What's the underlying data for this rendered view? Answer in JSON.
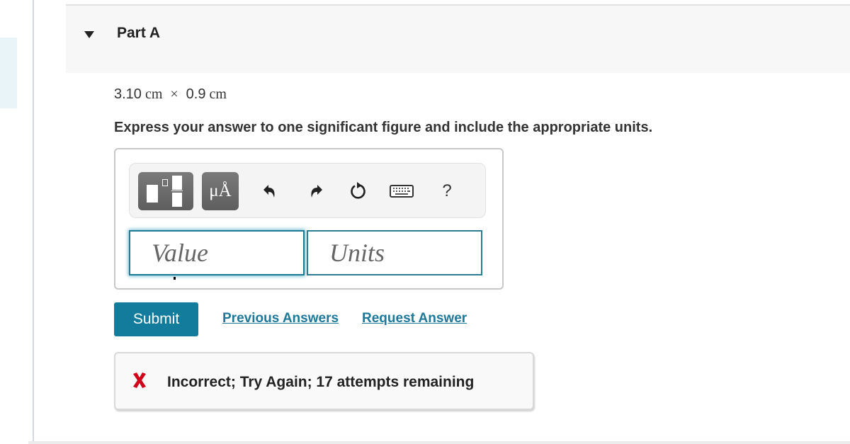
{
  "part": {
    "title": "Part A",
    "expanded": true
  },
  "problem": {
    "operand1_value": "3.10",
    "operand1_unit": "cm",
    "operator": "×",
    "operand2_value": "0.9",
    "operand2_unit": "cm"
  },
  "instructions": "Express your answer to one significant figure and include the appropriate units.",
  "toolbar": {
    "buttons": [
      {
        "icon": "templates-icon",
        "label": ""
      },
      {
        "icon": "units-icon",
        "label": "μÅ"
      },
      {
        "icon": "undo-icon",
        "label": ""
      },
      {
        "icon": "redo-icon",
        "label": ""
      },
      {
        "icon": "reset-icon",
        "label": ""
      },
      {
        "icon": "keyboard-icon",
        "label": ""
      },
      {
        "icon": "help-icon",
        "label": "?"
      }
    ]
  },
  "inputs": {
    "value_placeholder": "Value",
    "value_current": "",
    "units_placeholder": "Units",
    "units_current": ""
  },
  "actions": {
    "submit_label": "Submit",
    "previous_answers_label": "Previous Answers",
    "request_answer_label": "Request Answer"
  },
  "feedback": {
    "status": "incorrect",
    "message": "Incorrect; Try Again; 17 attempts remaining",
    "attempts_remaining": 17
  },
  "colors": {
    "accent": "#137b9b",
    "link": "#1d7899",
    "error": "#d0021b"
  }
}
